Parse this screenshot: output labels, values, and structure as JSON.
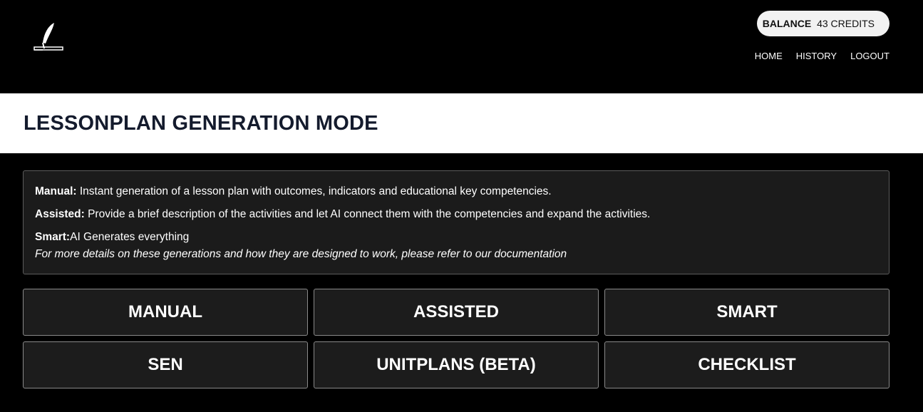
{
  "header": {
    "logo_icon": "quill-pen-icon",
    "balance": {
      "label": "BALANCE",
      "value": "43 CREDITS"
    },
    "nav": {
      "home": "HOME",
      "history": "HISTORY",
      "logout": "LOGOUT"
    }
  },
  "page": {
    "title": "LESSONPLAN GENERATION MODE"
  },
  "info": {
    "manual_label": "Manual:",
    "manual_text": " Instant generation of a lesson plan with outcomes, indicators and educational key competencies.",
    "assisted_label": "Assisted:",
    "assisted_text": " Provide a brief description of the activities and let AI connect them with the competencies and expand the activities.",
    "smart_label": "Smart:",
    "smart_text": "AI Generates everything",
    "doc_note": "For more details on these generations and how they are designed to work, please refer to our documentation"
  },
  "modes": {
    "manual": "MANUAL",
    "assisted": "ASSISTED",
    "smart": "SMART",
    "sen": "SEN",
    "unitplans": "UNITPLANS (BETA)",
    "checklist": "CHECKLIST"
  },
  "colors": {
    "background": "#000000",
    "panel": "#1b1b1b",
    "title_text": "#141b2d",
    "pill": "#f2f2f2"
  }
}
